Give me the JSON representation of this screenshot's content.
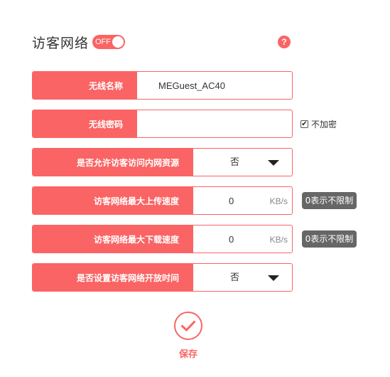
{
  "header": {
    "title": "访客网络",
    "toggle_label": "OFF",
    "help_symbol": "?"
  },
  "colors": {
    "accent": "#fa6464",
    "badge": "#666666"
  },
  "fields": {
    "ssid": {
      "label": "无线名称",
      "value": "MEGuest_AC40"
    },
    "password": {
      "label": "无线密码",
      "value": ""
    },
    "no_encrypt": {
      "label": "不加密",
      "checked": true
    },
    "intranet_access": {
      "label": "是否允许访客访问内网资源",
      "selected": "否"
    },
    "max_upload": {
      "label": "访客网络最大上传速度",
      "value": "0",
      "unit": "KB/s",
      "hint": "0表示不限制"
    },
    "max_download": {
      "label": "访客网络最大下载速度",
      "value": "0",
      "unit": "KB/s",
      "hint": "0表示不限制"
    },
    "schedule": {
      "label": "是否设置访客网络开放时间",
      "selected": "否"
    }
  },
  "actions": {
    "save_label": "保存"
  },
  "icons": {
    "help": "help-icon",
    "dropdown": "chevron-down-icon",
    "save": "check-icon"
  }
}
